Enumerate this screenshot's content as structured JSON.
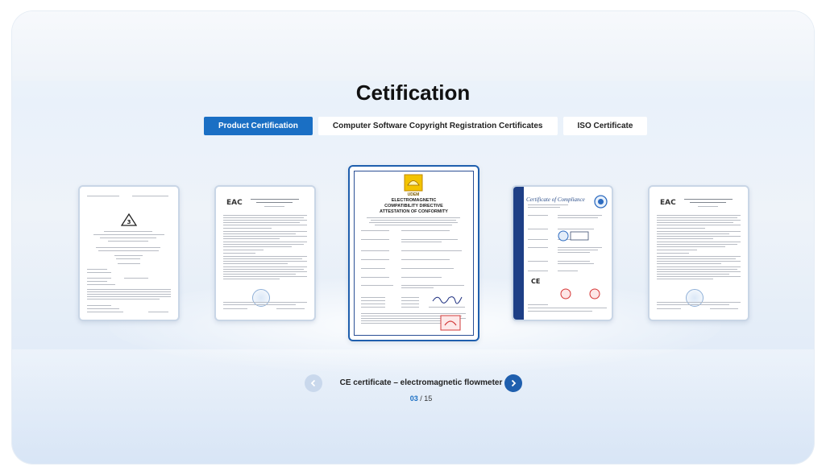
{
  "page": {
    "title": "Cetification",
    "tabs": [
      {
        "label": "Product Certification",
        "active": true
      },
      {
        "label": "Computer Software Copyright Registration Certificates",
        "active": false
      },
      {
        "label": "ISO Certificate",
        "active": false
      }
    ]
  },
  "carousel": {
    "caption": "CE certificate – electromagnetic flowmeter",
    "current": "03",
    "separator": " / ",
    "total": "15",
    "certificates": [
      {
        "kind": "doc-3"
      },
      {
        "kind": "eac"
      },
      {
        "kind": "ce-emc",
        "active": true
      },
      {
        "kind": "compliance"
      },
      {
        "kind": "eac"
      }
    ]
  },
  "center_cert": {
    "brand": "UDEM",
    "heading_1": "ELECTROMAGNETIC",
    "heading_2": "COMPATIBILITY DIRECTIVE",
    "heading_3": "ATTESTATION OF CONFORMITY"
  },
  "compliance_cert": {
    "heading": "Certificate of Compliance"
  },
  "eac_mark": "EAC",
  "colors": {
    "accent": "#1a6fc4",
    "active_border": "#1f5fae",
    "prev_button": "#c9d8ec",
    "next_button": "#1f5fae"
  },
  "icons": {
    "prev": "chevron-left-icon",
    "next": "chevron-right-icon"
  }
}
